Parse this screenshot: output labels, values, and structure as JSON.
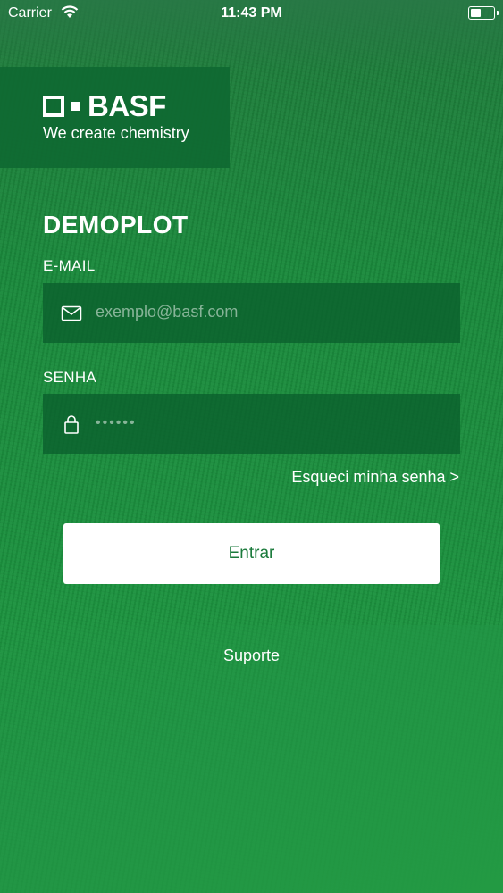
{
  "status_bar": {
    "carrier": "Carrier",
    "time": "11:43 PM",
    "wifi_icon": "wifi-icon",
    "battery_icon": "battery-icon"
  },
  "brand": {
    "logo_text": "BASF",
    "tagline": "We create chemistry"
  },
  "app_title": "DEMOPLOT",
  "email": {
    "label": "E-MAIL",
    "placeholder": "exemplo@basf.com",
    "icon": "envelope-icon"
  },
  "password": {
    "label": "SENHA",
    "value": "••••••",
    "icon": "lock-icon"
  },
  "forgot_link": "Esqueci minha senha >",
  "login_button": "Entrar",
  "support_link": "Suporte",
  "colors": {
    "brand_green": "#0f6932",
    "background_green": "#1b8f3e",
    "button_text": "#1a7a3b"
  }
}
